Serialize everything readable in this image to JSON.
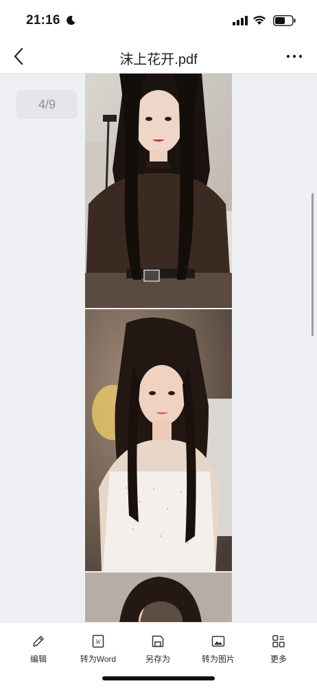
{
  "status_bar": {
    "time": "21:16",
    "icons": [
      "moon-icon",
      "cellular-signal-icon",
      "wifi-icon",
      "battery-icon"
    ]
  },
  "nav": {
    "title": "沫上花开.pdf",
    "back_icon": "chevron-left-icon",
    "more_icon": "ellipsis-icon"
  },
  "viewer": {
    "page_indicator": "4/9",
    "pages": [
      {
        "description_icon": "photo-page",
        "visible": "partial-top-cut"
      },
      {
        "description_icon": "photo-page",
        "visible": "full"
      },
      {
        "description_icon": "photo-page",
        "visible": "partial-bottom-cut"
      }
    ]
  },
  "toolbar": {
    "items": [
      {
        "label": "编辑",
        "icon": "pencil-icon"
      },
      {
        "label": "转为Word",
        "icon": "word-file-icon"
      },
      {
        "label": "另存为",
        "icon": "save-icon"
      },
      {
        "label": "转为图片",
        "icon": "image-icon"
      },
      {
        "label": "更多",
        "icon": "grid-more-icon"
      }
    ]
  },
  "colors": {
    "background": "#eff0f4",
    "bar_background": "#ffffff",
    "indicator_bg": "#e5e6ea",
    "indicator_text": "#8d8f96"
  }
}
